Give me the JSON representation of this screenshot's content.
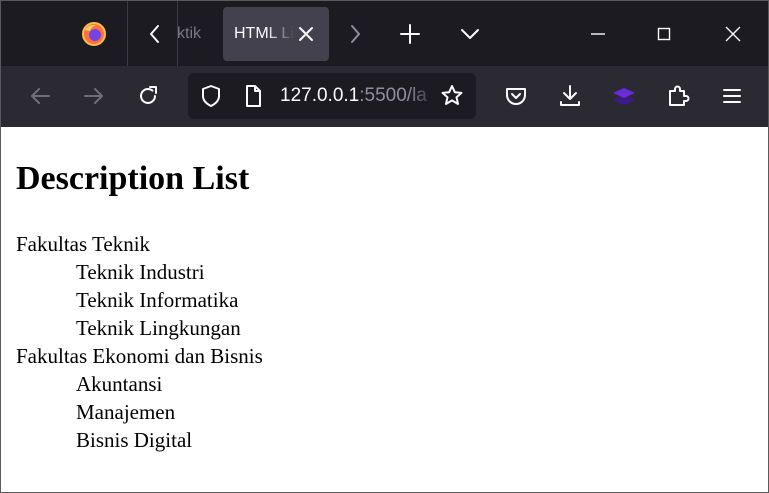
{
  "browser": {
    "tabs": {
      "previous_tab_title": "ktik",
      "active_tab_title": "HTML List"
    },
    "url": {
      "host": "127.0.0.1",
      "path": ":5500/la"
    },
    "colors": {
      "tab_strip": "#1c1b22",
      "toolbar": "#2b2a33",
      "active_tab": "#42414d",
      "extension_accent": "#6b2bd9"
    }
  },
  "page": {
    "title": "Description List",
    "groups": [
      {
        "term": "Fakultas Teknik",
        "items": [
          "Teknik Industri",
          "Teknik Informatika",
          "Teknik Lingkungan"
        ]
      },
      {
        "term": "Fakultas Ekonomi dan Bisnis",
        "items": [
          "Akuntansi",
          "Manajemen",
          "Bisnis Digital"
        ]
      }
    ]
  }
}
